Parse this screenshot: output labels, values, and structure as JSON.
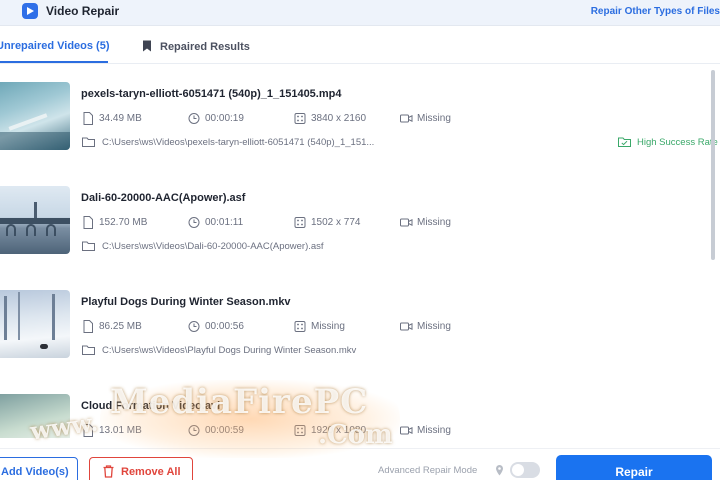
{
  "window": {
    "title": "Video Repair",
    "top_link": "Repair Other Types of Files"
  },
  "tabs": [
    {
      "label": "Unrepaired Videos (5)",
      "active": true
    },
    {
      "label": "Repaired Results",
      "active": false
    }
  ],
  "videos": [
    {
      "name": "pexels-taryn-elliott-6051471 (540p)_1_151405.mp4",
      "size": "34.49 MB",
      "duration": "00:00:19",
      "resolution": "3840 x 2160",
      "status": "Missing",
      "path": "C:\\Users\\ws\\Videos\\pexels-taryn-elliott-6051471 (540p)_1_151...",
      "badge": "High Success Rate"
    },
    {
      "name": "Dali-60-20000-AAC(Apower).asf",
      "size": "152.70 MB",
      "duration": "00:01:11",
      "resolution": "1502 x 774",
      "status": "Missing",
      "path": "C:\\Users\\ws\\Videos\\Dali-60-20000-AAC(Apower).asf"
    },
    {
      "name": "Playful Dogs During Winter Season.mkv",
      "size": "86.25 MB",
      "duration": "00:00:56",
      "resolution": "Missing",
      "status": "Missing",
      "path": "C:\\Users\\ws\\Videos\\Playful Dogs During Winter Season.mkv"
    },
    {
      "name": "Cloud Formation Video.avi",
      "size": "13.01 MB",
      "duration": "00:00:59",
      "resolution": "1920 x 1080",
      "status": "Missing"
    }
  ],
  "footer": {
    "add_label": "Add Video(s)",
    "remove_label": "Remove All",
    "advanced_label": "Advanced Repair Mode",
    "advanced_enabled": false,
    "repair_label": "Repair"
  },
  "watermark": {
    "main": "MediaFirePC",
    "prefix": "www.",
    "suffix": ".Com"
  },
  "colors": {
    "accent": "#2b6de0",
    "primary_button": "#1a73f0",
    "danger": "#e0453c",
    "success": "#3aa869"
  }
}
